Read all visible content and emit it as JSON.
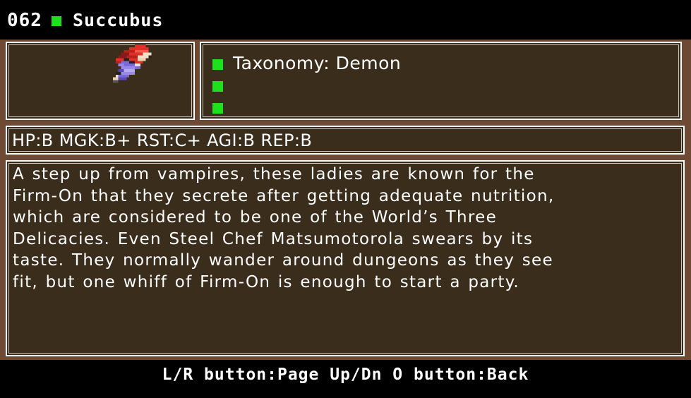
{
  "header": {
    "entry_number": "062",
    "monster_name": "Succubus"
  },
  "sprite": {
    "icon": "succubus-sprite-icon"
  },
  "info": {
    "rows": [
      {
        "label": "Taxonomy: Demon"
      },
      {
        "label": ""
      },
      {
        "label": ""
      }
    ]
  },
  "stats": {
    "text": "HP:B MGK:B+ RST:C+ AGI:B REP:B"
  },
  "description": {
    "lines": [
      "A step up from vampires, these ladies are known for the",
      "Firm-On that they secrete after getting adequate nutrition,",
      "which are considered to be one of the World’s Three",
      "Delicacies. Even Steel Chef Matsumotorola swears by its",
      "taste. They normally wander around dungeons as they see",
      "fit, but one whiff of Firm-On is enough to start a party."
    ]
  },
  "footer": {
    "controls": "L/R button:Page Up/Dn O button:Back"
  },
  "colors": {
    "background": "#6e4a35",
    "panel": "#3b2d1c",
    "accent_green": "#1ee11e",
    "border": "#ffffff"
  }
}
